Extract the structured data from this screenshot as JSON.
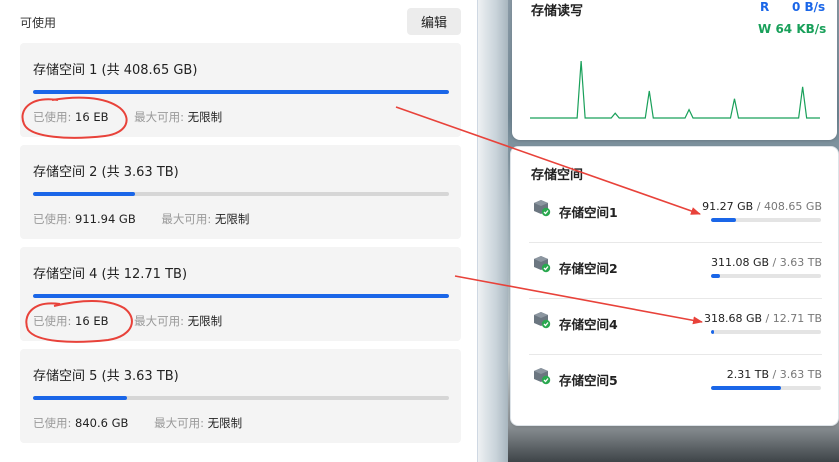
{
  "left": {
    "section_title": "可使用",
    "edit_label": "编辑",
    "used_key": "已使用:",
    "max_key": "最大可用:",
    "pools": [
      {
        "title": "存储空间 1 (共 408.65 GB)",
        "used": "16 EB",
        "max": "无限制",
        "usage_fraction": 1.0
      },
      {
        "title": "存储空间 2 (共 3.63 TB)",
        "used": "911.94 GB",
        "max": "无限制",
        "usage_fraction": 0.245
      },
      {
        "title": "存储空间 4 (共 12.71 TB)",
        "used": "16 EB",
        "max": "无限制",
        "usage_fraction": 1.0
      },
      {
        "title": "存储空间 5 (共 3.63 TB)",
        "used": "840.6 GB",
        "max": "无限制",
        "usage_fraction": 0.226
      }
    ]
  },
  "io_widget": {
    "title": "存储读写",
    "read_label": "R",
    "read_value": "0 B/s",
    "write_label": "W",
    "write_value": "64 KB/s",
    "spike_positions": [
      0.18,
      0.3,
      0.42,
      0.56,
      0.72,
      0.96
    ],
    "spike_heights": [
      0.95,
      0.08,
      0.45,
      0.14,
      0.32,
      0.52
    ],
    "colors": {
      "read": "#1a66e8",
      "write": "#19a05a"
    }
  },
  "storage_widget": {
    "title": "存储空间",
    "items": [
      {
        "name": "存储空间1",
        "used": "91.27 GB",
        "total": "408.65 GB",
        "usage_fraction": 0.223
      },
      {
        "name": "存储空间2",
        "used": "311.08 GB",
        "total": "3.63 TB",
        "usage_fraction": 0.084
      },
      {
        "name": "存储空间4",
        "used": "318.68 GB",
        "total": "12.71 TB",
        "usage_fraction": 0.025
      },
      {
        "name": "存储空间5",
        "used": "2.31 TB",
        "total": "3.63 TB",
        "usage_fraction": 0.636
      }
    ]
  },
  "colors": {
    "accent": "#1a66e8",
    "annotation": "#e8423a",
    "track": "#d6d6d6"
  }
}
